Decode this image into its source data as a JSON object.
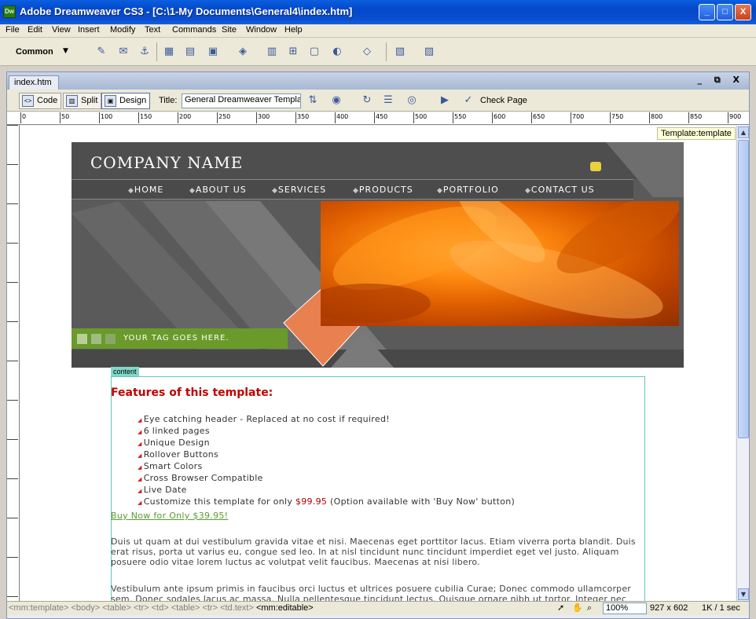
{
  "window": {
    "title": "Adobe Dreamweaver CS3 - [C:\\1-My Documents\\General4\\index.htm]",
    "app_icon": "Dw",
    "min": "_",
    "max": "□",
    "close": "X"
  },
  "menu": [
    "File",
    "Edit",
    "View",
    "Insert",
    "Modify",
    "Text",
    "Commands",
    "Site",
    "Window",
    "Help"
  ],
  "insert_bar": {
    "category": "Common"
  },
  "document": {
    "tab": "index.htm",
    "controls": "_ ⧉ X",
    "view_buttons": {
      "code": "Code",
      "split": "Split",
      "design": "Design"
    },
    "title_label": "Title:",
    "title_value": "General Dreamweaver Template",
    "check_page": "Check Page"
  },
  "ruler": {
    "h_labels": [
      "0",
      "50",
      "100",
      "150",
      "200",
      "250",
      "300",
      "350",
      "400",
      "450",
      "500",
      "550",
      "600",
      "650",
      "700",
      "750",
      "800",
      "850",
      "900"
    ]
  },
  "canvas": {
    "template_badge": "Template:template",
    "company_name": "COMPANY NAME",
    "nav": [
      "HOME",
      "ABOUT US",
      "SERVICES",
      "PRODUCTS",
      "PORTFOLIO",
      "CONTACT US"
    ],
    "tagline": "YOUR TAG GOES HERE.",
    "content_label": "content",
    "features_title": "Features of this template:",
    "features": [
      "Eye catching header - Replaced at no cost if required!",
      "6 linked pages",
      "Unique Design",
      "Rollover Buttons",
      "Smart Colors",
      "Cross Browser Compatible",
      "Live Date"
    ],
    "customize_pre": "Customize this template for only ",
    "customize_price": "$99.95",
    "customize_post": " (Option available with 'Buy Now' button)",
    "buy_now": "Buy Now for Only $39.95!",
    "para1": "Duis ut quam at dui vestibulum gravida vitae et nisi. Maecenas eget porttitor lacus. Etiam viverra porta blandit. Duis erat risus, porta ut varius eu, congue sed leo. In at nisl tincidunt nunc tincidunt imperdiet eget vel justo. Aliquam posuere odio vitae lorem luctus ac volutpat velit faucibus. Maecenas at nisi libero.",
    "para2": "Vestibulum ante ipsum primis in faucibus orci luctus et ultrices posuere cubilia Curae; Donec commodo ullamcorper sem. Donec sodales lacus ac massa. Nulla pellentesque tincidunt lectus. Quisque ornare nibh ut tortor. Integer nec"
  },
  "status": {
    "tag_path": "<mm:template> <body> <table> <tr> <td> <table> <tr> <td.text>",
    "current_tag": "<mm:editable>",
    "zoom": "100%",
    "window_size": "927 x 602",
    "doc_size": "1K / 1 sec"
  },
  "colors": {
    "accent_green": "#6a9a2a",
    "feature_red": "#c00000",
    "link_green": "#5a9a30"
  }
}
